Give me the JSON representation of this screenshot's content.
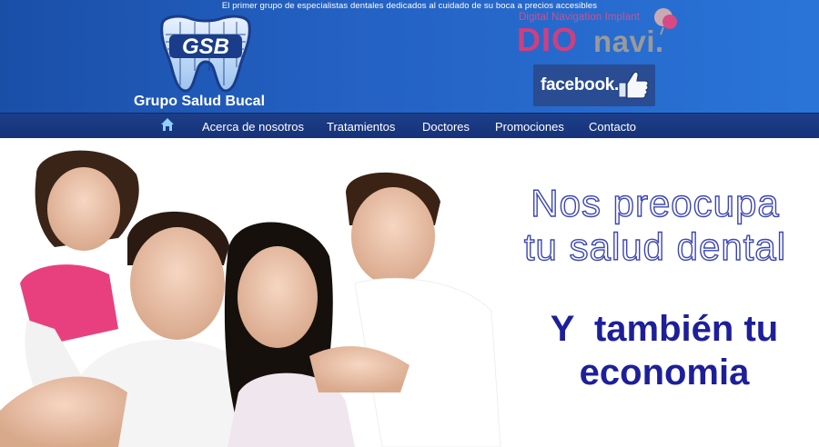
{
  "header": {
    "tagline": "El primer grupo de especialistas dentales dedicados al cuidado de su boca a precios accesibles",
    "logo_text": "GSB",
    "brand_name": "Grupo Salud Bucal",
    "partner": {
      "subtitle": "Digital Navigation Implant",
      "name_main": "DIO",
      "name_secondary": "navi."
    },
    "facebook_label": "facebook."
  },
  "nav": {
    "home_icon": "home-icon",
    "items": [
      {
        "label": "Acerca de nosotros"
      },
      {
        "label": "Tratamientos"
      },
      {
        "label": "Doctores"
      },
      {
        "label": "Promociones"
      },
      {
        "label": "Contacto"
      }
    ]
  },
  "hero": {
    "headline_line1": "Nos preocupa",
    "headline_line2": "tu salud dental",
    "subheadline_line1": "Y  también tu",
    "subheadline_line2": "economia"
  },
  "colors": {
    "header_blue": "#2462c4",
    "nav_blue": "#1a3a82",
    "dio_pink": "#cf3f7f",
    "headline_outline": "#3c46b4",
    "subheadline": "#1d1f9a",
    "facebook_blue": "#294c93"
  }
}
